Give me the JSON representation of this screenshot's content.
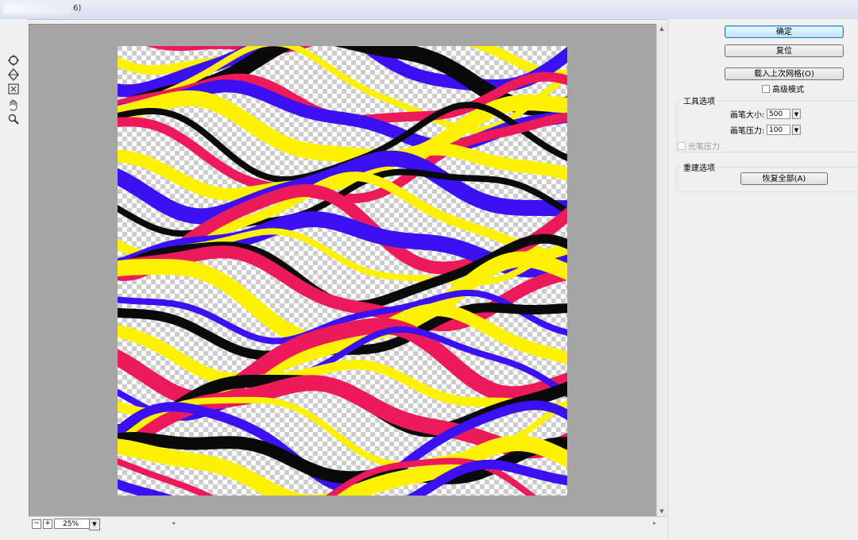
{
  "window": {
    "title_fragment": "6)"
  },
  "tools": [
    {
      "name": "reconstruct-tool",
      "icon": "reconstruct-icon"
    },
    {
      "name": "smooth-tool",
      "icon": "smooth-icon"
    },
    {
      "name": "pucker-tool",
      "icon": "pucker-icon"
    },
    {
      "name": "hand-tool",
      "icon": "hand-icon"
    },
    {
      "name": "zoom-tool",
      "icon": "zoom-icon"
    }
  ],
  "statusbar": {
    "zoom_out": "−",
    "zoom_in": "+",
    "zoom_value": "25%"
  },
  "panel": {
    "ok_label": "确定",
    "reset_label": "复位",
    "load_mesh_label": "载入上次网格(O)",
    "advanced_mode_label": "高级模式",
    "tool_options": {
      "group_label": "工具选项",
      "brush_size_label": "画笔大小:",
      "brush_size_value": "500",
      "brush_pressure_label": "画笔压力:",
      "brush_pressure_value": "100",
      "stylus_pressure_label": "光笔压力"
    },
    "reconstruct_options": {
      "group_label": "重建选项",
      "restore_all_label": "恢复全部(A)"
    }
  },
  "colors": {
    "magenta": "#ec1a5b",
    "yellow": "#fff200",
    "blue": "#3b10f2",
    "black": "#0a0a0a",
    "canvas_bg": "#a5a5a5"
  }
}
